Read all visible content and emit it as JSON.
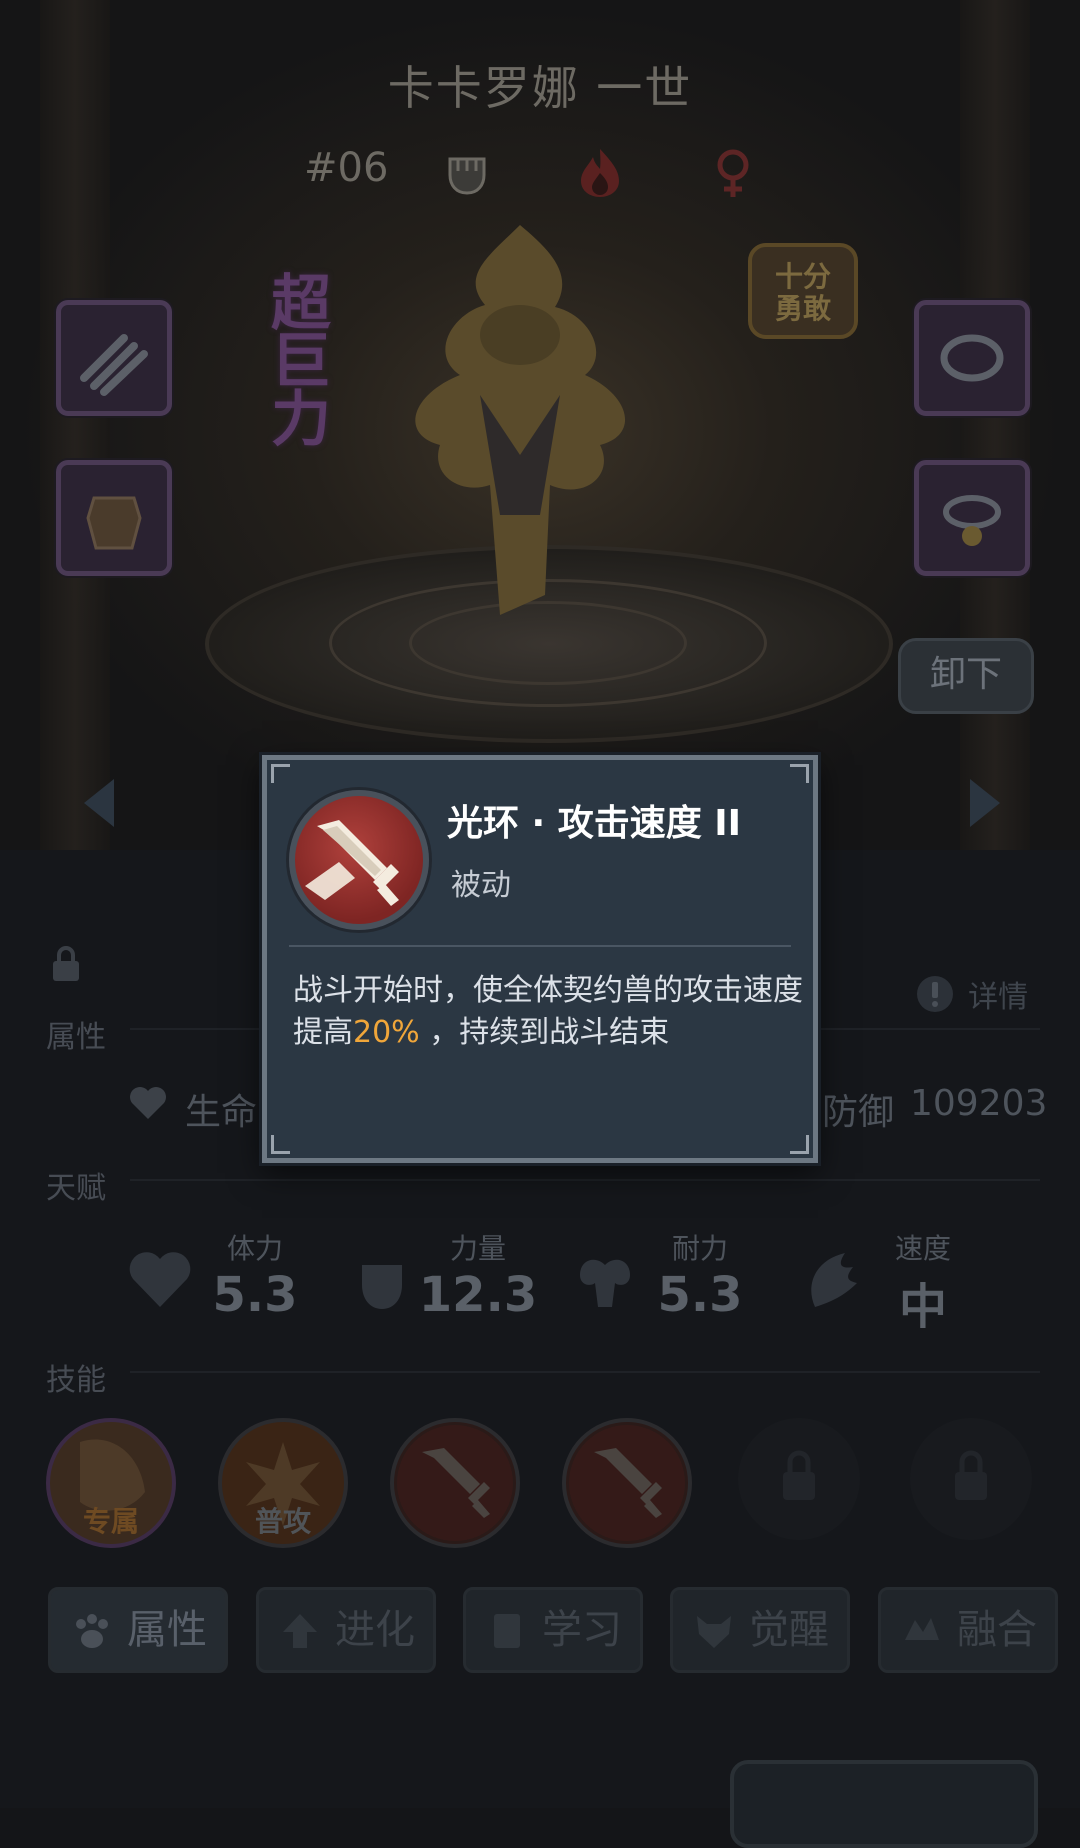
{
  "header": {
    "pet_name": "卡卡罗娜 一世",
    "number": "#06",
    "type_icons": [
      "fist-icon",
      "fire-icon",
      "female-icon"
    ]
  },
  "badges": {
    "super_power": "超\n巨\n力",
    "brave": "十分\n勇敢"
  },
  "buttons": {
    "unequip": "卸下",
    "details": "详情"
  },
  "sections": {
    "attributes": "属性",
    "talent": "天赋",
    "skills": "技能"
  },
  "attributes": {
    "hp_label": "生命",
    "def_label": "防御",
    "def_value": "109203"
  },
  "talents": [
    {
      "label": "体力",
      "value": "5.3",
      "icon": "heart-icon"
    },
    {
      "label": "力量",
      "value": "12.3",
      "icon": "fist-icon"
    },
    {
      "label": "耐力",
      "value": "5.3",
      "icon": "muscle-icon"
    },
    {
      "label": "速度",
      "value": "中",
      "icon": "wing-icon"
    }
  ],
  "skills": [
    {
      "tag": "专属",
      "icon": "exclusive-skill-icon"
    },
    {
      "tag": "普攻",
      "icon": "normal-attack-icon"
    },
    {
      "tag": "",
      "icon": "sword-icon"
    },
    {
      "tag": "",
      "icon": "sword-icon"
    }
  ],
  "tabs": [
    {
      "label": "属性",
      "icon": "paw-icon"
    },
    {
      "label": "进化",
      "icon": "up-arrow-icon"
    },
    {
      "label": "学习",
      "icon": "book-icon"
    },
    {
      "label": "觉醒",
      "icon": "wolf-icon"
    },
    {
      "label": "融合",
      "icon": "fusion-icon"
    }
  ],
  "popup": {
    "title": "光环 · 攻击速度 II",
    "type": "被动",
    "desc_before": "战斗开始时，使全体契约兽的攻击速度提高",
    "desc_highlight": "20%",
    "desc_after": " ，持续到战斗结束"
  },
  "colors": {
    "highlight": "#f0a63a",
    "popup_bg": "#2b3743",
    "skill_red": "#b0413c"
  }
}
